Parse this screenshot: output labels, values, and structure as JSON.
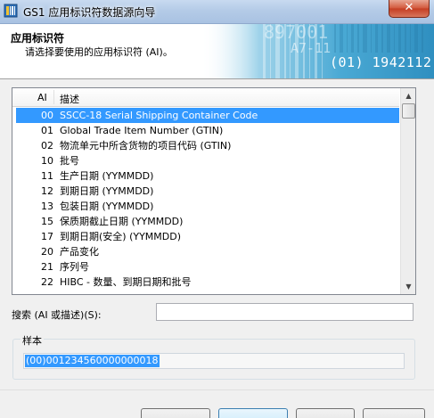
{
  "window": {
    "title": "GS1 应用标识符数据源向导",
    "close_symbol": "✕",
    "icon": "wizard-app-icon"
  },
  "banner": {
    "title": "应用标识符",
    "subtitle": "请选择要使用的应用标识符 (AI)。",
    "barcode_text": "(01) 1942112"
  },
  "list": {
    "columns": {
      "ai": "AI",
      "description": "描述"
    },
    "rows": [
      {
        "ai": "00",
        "description": "SSCC-18 Serial Shipping Container Code",
        "selected": true
      },
      {
        "ai": "01",
        "description": "Global Trade Item Number (GTIN)"
      },
      {
        "ai": "02",
        "description": "物流单元中所含货物的项目代码 (GTIN)"
      },
      {
        "ai": "10",
        "description": "批号"
      },
      {
        "ai": "11",
        "description": "生产日期 (YYMMDD)"
      },
      {
        "ai": "12",
        "description": "到期日期 (YYMMDD)"
      },
      {
        "ai": "13",
        "description": "包装日期 (YYMMDD)"
      },
      {
        "ai": "15",
        "description": "保质期截止日期 (YYMMDD)"
      },
      {
        "ai": "17",
        "description": "到期日期(安全) (YYMMDD)"
      },
      {
        "ai": "20",
        "description": "产品变化"
      },
      {
        "ai": "21",
        "description": "序列号"
      },
      {
        "ai": "22",
        "description": "HIBC - 数量、到期日期和批号"
      }
    ]
  },
  "search": {
    "label": "搜索 (AI 或描述)(S):",
    "value": ""
  },
  "sample": {
    "label": "样本",
    "value": "(00)001234560000000018"
  },
  "colors": {
    "selection": "#3399ff",
    "banner_art": "#3fa3cf"
  }
}
